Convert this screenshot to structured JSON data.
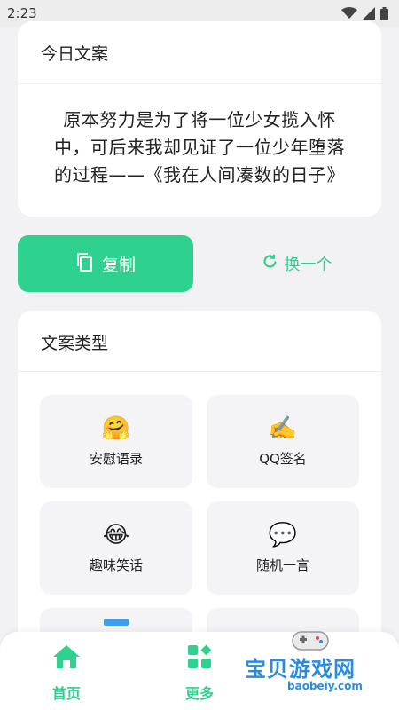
{
  "status_bar": {
    "time": "2:23"
  },
  "quote_card": {
    "title": "今日文案",
    "text": "原本努力是为了将一位少女揽入怀中，可后来我却见证了一位少年堕落的过程——《我在人间凑数的日子》"
  },
  "actions": {
    "copy_label": "复制",
    "swap_label": "换一个"
  },
  "types_card": {
    "title": "文案类型",
    "items": [
      {
        "emoji": "🤗",
        "label": "安慰语录"
      },
      {
        "emoji": "✍️",
        "label": "QQ签名"
      },
      {
        "emoji": "😂",
        "label": "趣味笑话"
      },
      {
        "emoji": "💬",
        "label": "随机一言"
      }
    ]
  },
  "bottom_nav": {
    "home_label": "首页",
    "more_label": "更多"
  },
  "watermark": {
    "text": "宝贝游戏网",
    "url": "baobeiy.com"
  },
  "colors": {
    "accent": "#2ed18e",
    "background": "#f2f2f4",
    "watermark": "#2b8be0"
  }
}
